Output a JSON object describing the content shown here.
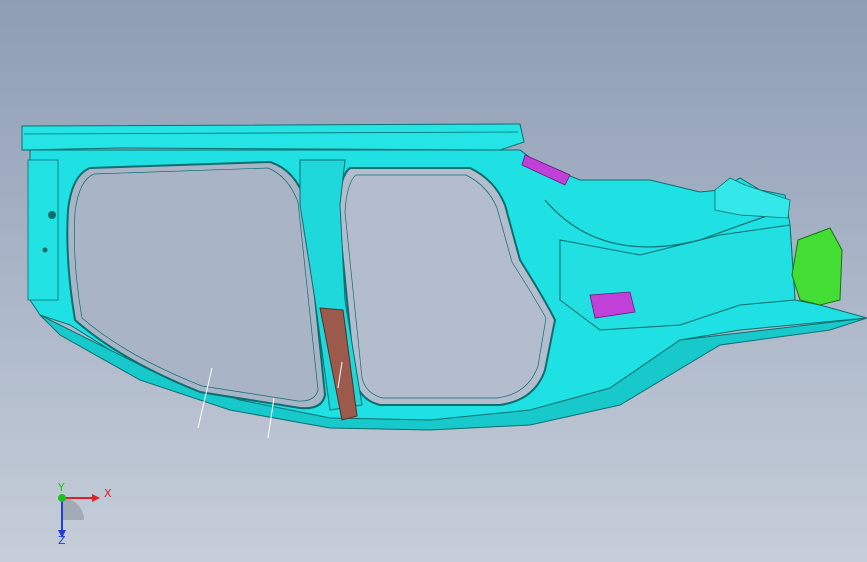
{
  "viewport": {
    "background_top": "#8e9db4",
    "background_bottom": "#c6ced9"
  },
  "model": {
    "parts": [
      {
        "name": "body-side-outer",
        "color": "#19e0e0"
      },
      {
        "name": "b-pillar-reinforcement",
        "color": "#9c5a4c"
      },
      {
        "name": "bracket-magenta",
        "color": "#c040d8"
      },
      {
        "name": "bracket-green",
        "color": "#44dd33"
      }
    ]
  },
  "triad": {
    "x_label": "X",
    "y_label": "Y",
    "z_label": "Z",
    "x_color": "#e02020",
    "y_color": "#20c020",
    "z_color": "#2040d0"
  }
}
